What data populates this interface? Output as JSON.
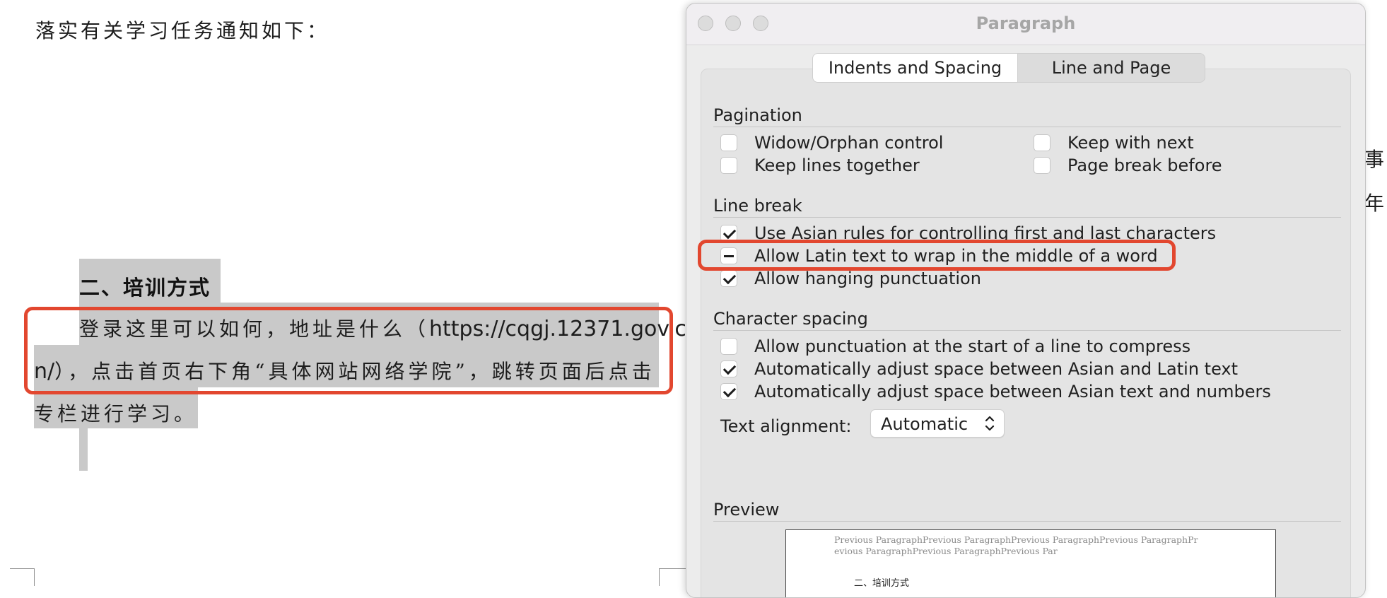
{
  "document": {
    "intro": "落实有关学习任务通知如下：",
    "heading": "二、培训方式",
    "para_line1_cn": "登录这里可以如何，地址是什么（",
    "para_line1_latin": "https://cqgj.12371.gov.c",
    "para_line2_latin": "n/",
    "para_line2_cn": "），点击首页右下角“具体网站网络学院”，跳转页面后点击",
    "para_line3": "专栏进行学习。",
    "edge_char_1": "事",
    "edge_char_2": "年"
  },
  "dialog": {
    "title": "Paragraph",
    "tabs": [
      {
        "label": "Indents and Spacing",
        "active": true
      },
      {
        "label": "Line and Page Breaks",
        "active": false
      }
    ],
    "pagination": {
      "label": "Pagination",
      "widow_orphan": {
        "label": "Widow/Orphan control",
        "state": "unchecked"
      },
      "keep_lines": {
        "label": "Keep lines together",
        "state": "unchecked"
      },
      "keep_next": {
        "label": "Keep with next",
        "state": "unchecked"
      },
      "page_break": {
        "label": "Page break before",
        "state": "unchecked"
      }
    },
    "line_break": {
      "label": "Line break",
      "asian_rules": {
        "label": "Use Asian rules for controlling first and last characters",
        "state": "checked"
      },
      "latin_wrap": {
        "label": "Allow Latin text to wrap in the middle of a word",
        "state": "mixed"
      },
      "hanging_punct": {
        "label": "Allow hanging punctuation",
        "state": "checked"
      }
    },
    "char_spacing": {
      "label": "Character spacing",
      "punct_compress": {
        "label": "Allow punctuation at the start of a line to compress",
        "state": "unchecked"
      },
      "asian_latin": {
        "label": "Automatically adjust space between Asian and Latin text",
        "state": "checked"
      },
      "asian_numbers": {
        "label": "Automatically adjust space between Asian text and numbers",
        "state": "checked"
      }
    },
    "text_alignment": {
      "label": "Text alignment:",
      "value": "Automatic"
    },
    "preview": {
      "label": "Preview",
      "previous_text": "Previous ParagraphPrevious ParagraphPrevious ParagraphPrevious ParagraphPrevious ParagraphPrevious ParagraphPrevious Par",
      "heading": "二、培训方式"
    }
  },
  "colors": {
    "highlight": "#e2472f",
    "selection": "#c9c9c9"
  }
}
